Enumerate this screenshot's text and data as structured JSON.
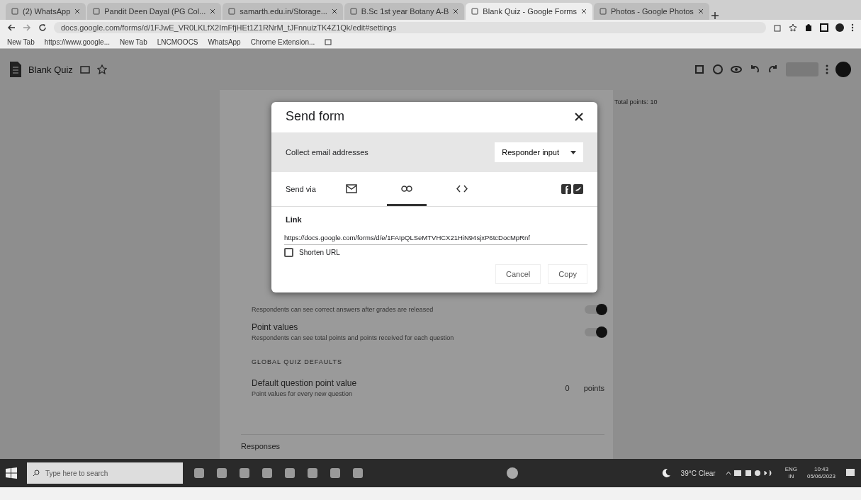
{
  "browser": {
    "tabs": [
      {
        "title": "(2) WhatsApp",
        "selected": false
      },
      {
        "title": "Pandit Deen Dayal (PG Col...",
        "selected": false
      },
      {
        "title": "samarth.edu.in/Storage...",
        "selected": false
      },
      {
        "title": "B.Sc 1st year Botany A-B",
        "selected": false
      },
      {
        "title": "Blank Quiz - Google Forms",
        "selected": true
      },
      {
        "title": "Photos - Google Photos",
        "selected": false
      }
    ],
    "address": "docs.google.com/forms/d/1FJwE_VR0LKLfX2ImFfjHEt1Z1RNrM_tJFnnuizTK4Z1Qk/edit#settings",
    "bookmarks": [
      "New Tab",
      "https://www.google...",
      "New Tab",
      "LNCMOOCS",
      "WhatsApp",
      "Chrome Extension..."
    ]
  },
  "app": {
    "title": "Blank Quiz",
    "total_points": "Total points: 10"
  },
  "settings": {
    "rows": [
      {
        "title": "",
        "description": "Respondents can see correct answers after grades are released",
        "on": true
      },
      {
        "title": "Point values",
        "description": "Respondents can see total points and points received for each question",
        "on": true
      }
    ],
    "section": "GLOBAL QUIZ DEFAULTS",
    "default_point": {
      "title": "Default question point value",
      "description": "Point values for every new question",
      "value": "0",
      "unit": "points"
    },
    "responses": "Responses"
  },
  "dialog": {
    "title": "Send form",
    "collect_label": "Collect email addresses",
    "collect_value": "Responder input",
    "send_via": "Send via",
    "methods": [
      {
        "kind": "email",
        "selected": false
      },
      {
        "kind": "link",
        "selected": true
      },
      {
        "kind": "embed",
        "selected": false
      }
    ],
    "link_heading": "Link",
    "link_url": "https://docs.google.com/forms/d/e/1FAIpQLSeMTVHCX21HiN94sjxP6tcDocMpRnf",
    "shorten_label": "Shorten URL",
    "shorten_checked": false,
    "buttons": [
      "Cancel",
      "Copy"
    ]
  },
  "taskbar": {
    "search_placeholder": "Type here to search",
    "weather": "39°C Clear",
    "lang": "ENG",
    "region": "IN",
    "time": "10:43",
    "date": "05/06/2023"
  }
}
